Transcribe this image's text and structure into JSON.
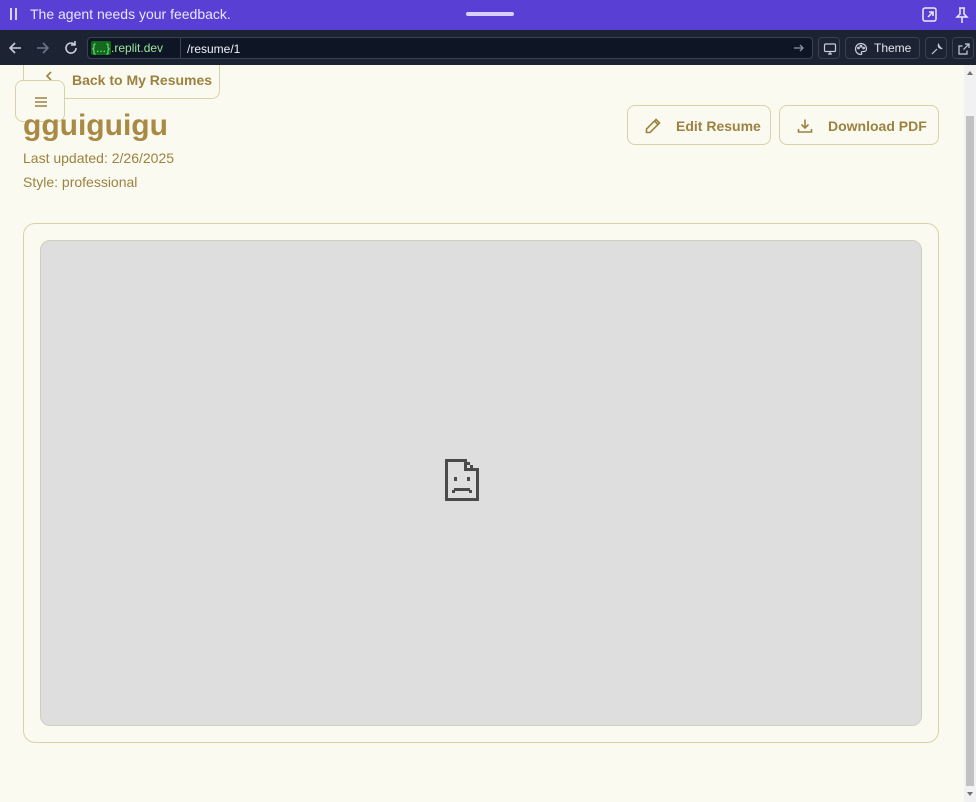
{
  "banner": {
    "message": "The agent needs your feedback.",
    "icons": [
      "drag-grip-icon",
      "expand-icon",
      "pin-icon"
    ]
  },
  "browser": {
    "host_capsule": "{...}",
    "host_suffix": ".replit.dev",
    "path": "/resume/1",
    "theme_label": "Theme"
  },
  "page": {
    "back_label": "Back to My Resumes",
    "resume_title": "gguiguigu",
    "last_updated": "Last updated: 2/26/2025",
    "style": "Style: professional",
    "edit_label": "Edit Resume",
    "download_label": "Download PDF"
  },
  "colors": {
    "accent": "#9c8240",
    "banner": "#5a3fd4",
    "browser_bar": "#1c2333",
    "page_bg": "#fbfaf0",
    "border": "#d7d2a8"
  }
}
